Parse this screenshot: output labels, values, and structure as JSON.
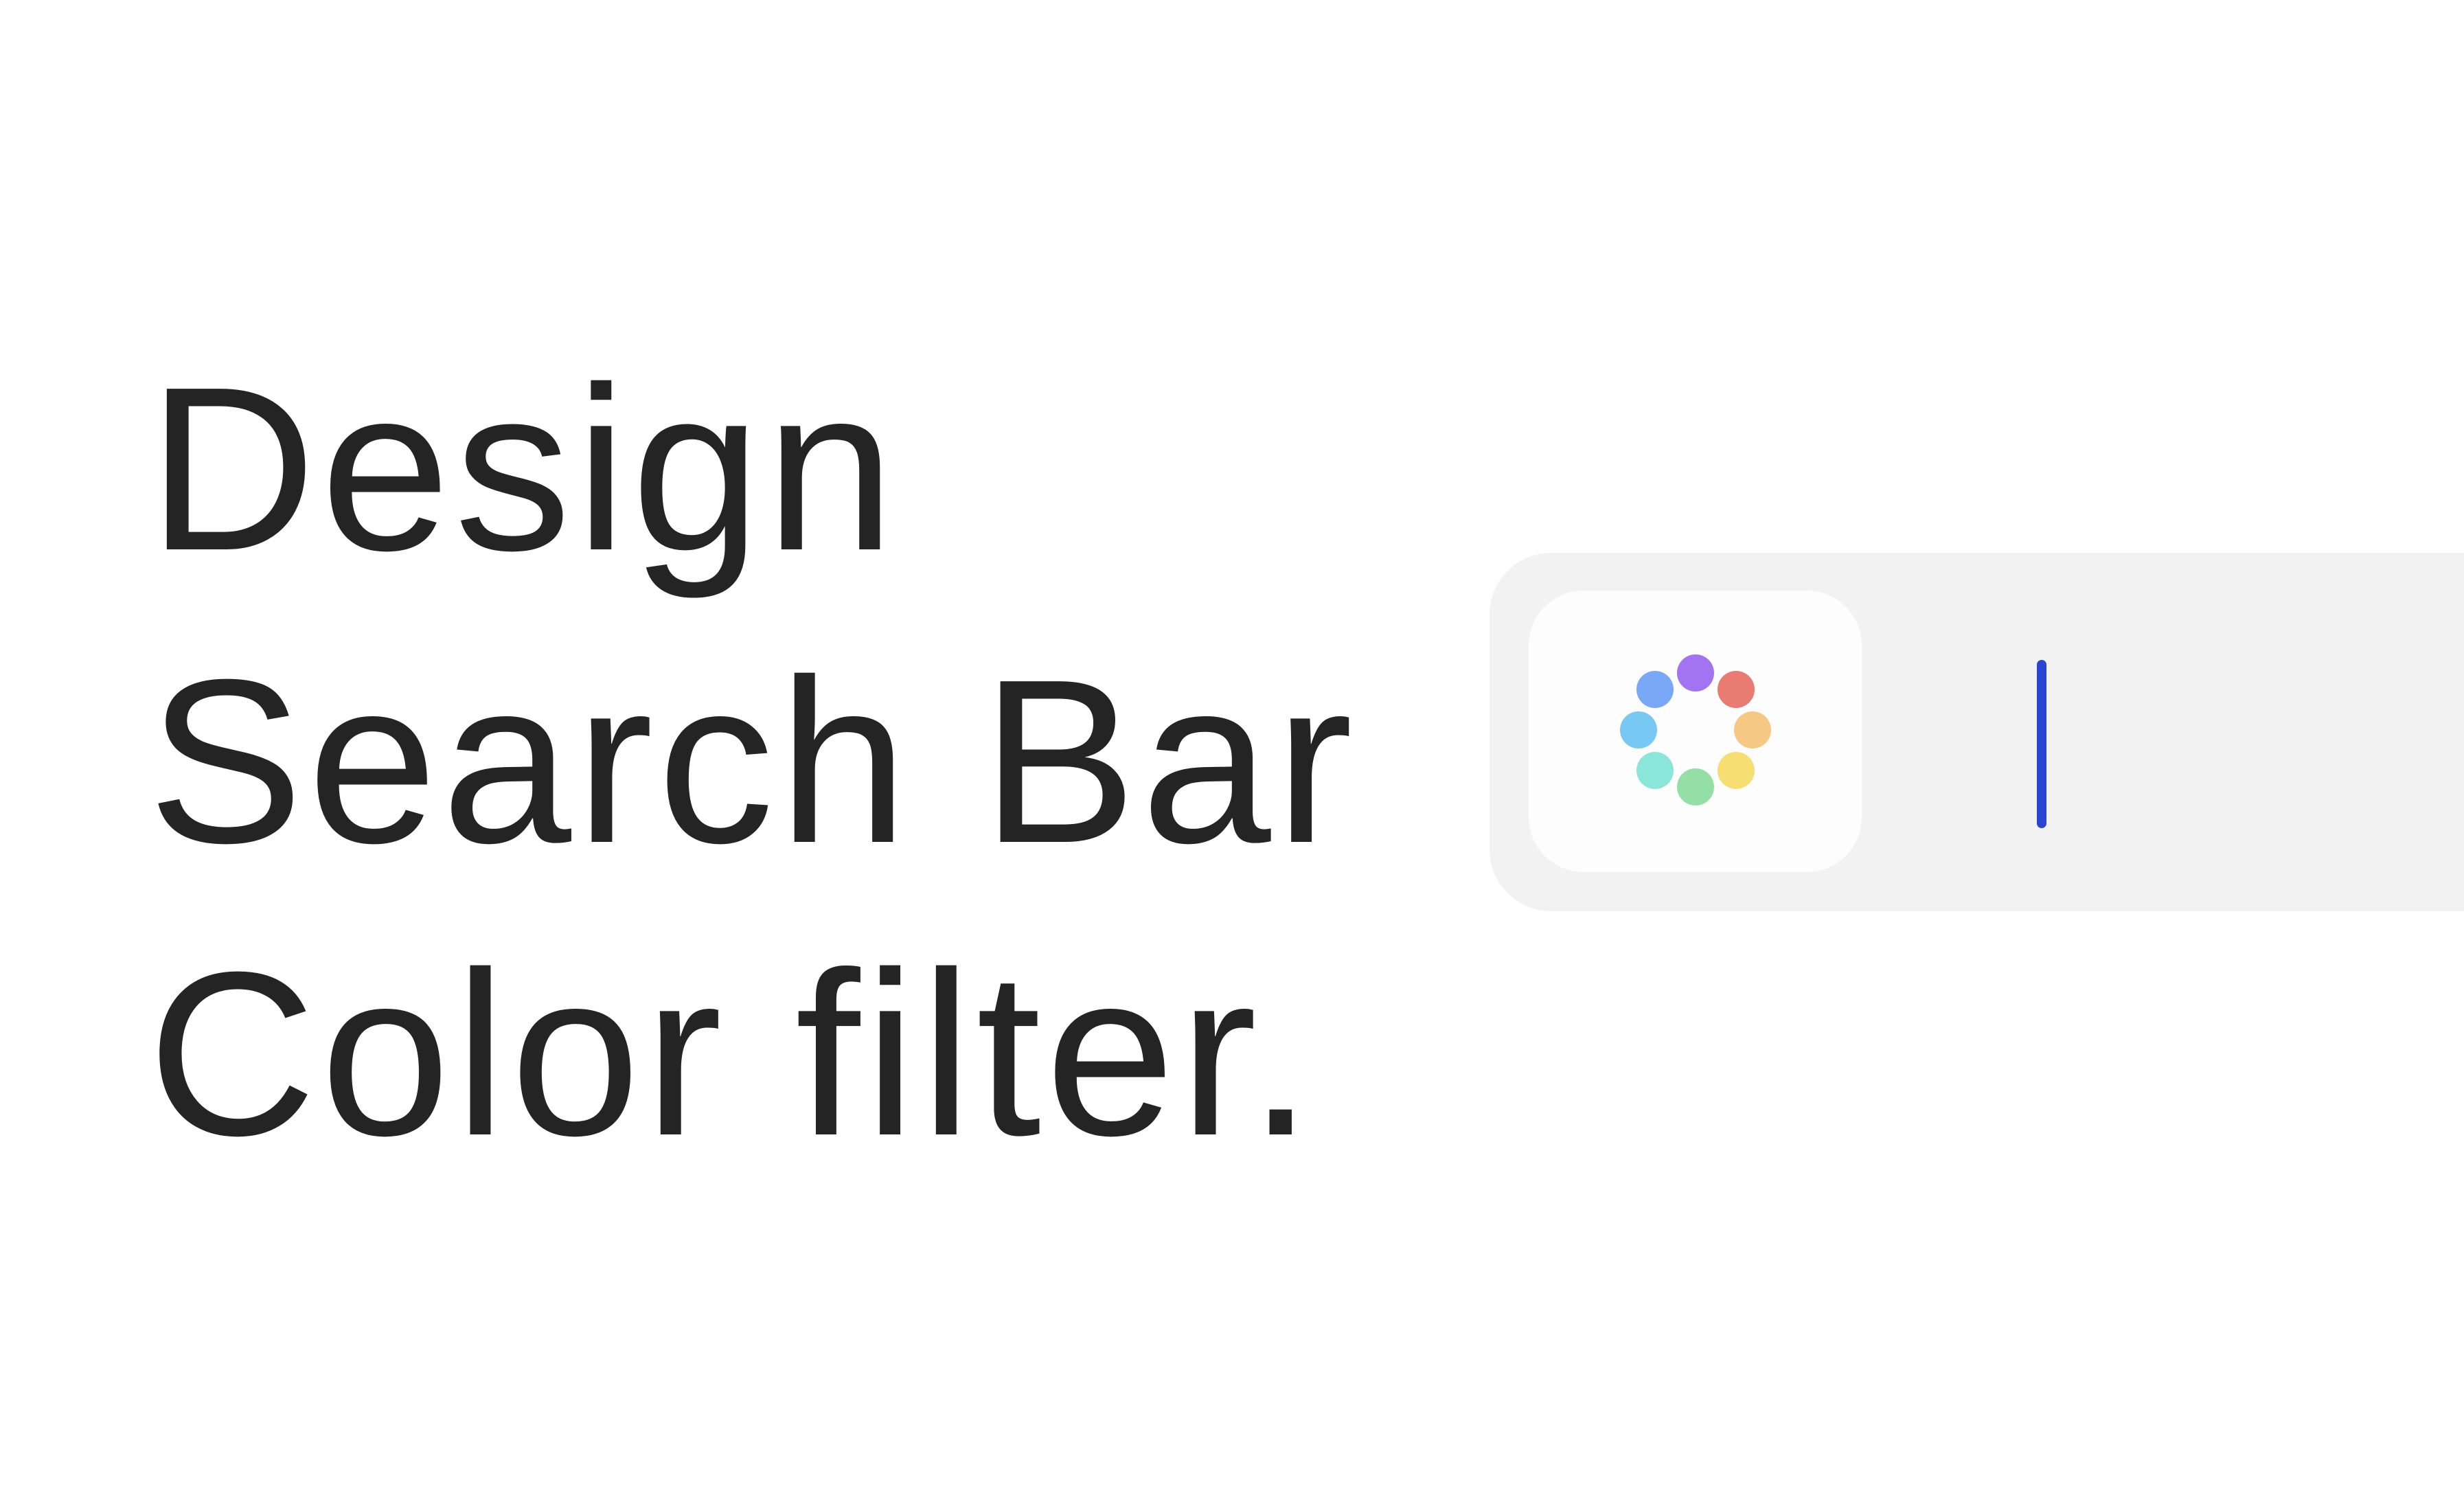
{
  "headline": {
    "lines": [
      "Design",
      "Search Bar",
      "Color filter."
    ]
  },
  "search_bar": {
    "filter_icon": "color-wheel-icon",
    "value": "",
    "cursor_color": "#2a44d4",
    "background_color": "#f2f2f2",
    "dot_colors": [
      "#a374f2",
      "#e97b72",
      "#f5c984",
      "#f7de72",
      "#93dfa5",
      "#8ae6d8",
      "#78c8f4",
      "#78a8f6"
    ]
  }
}
